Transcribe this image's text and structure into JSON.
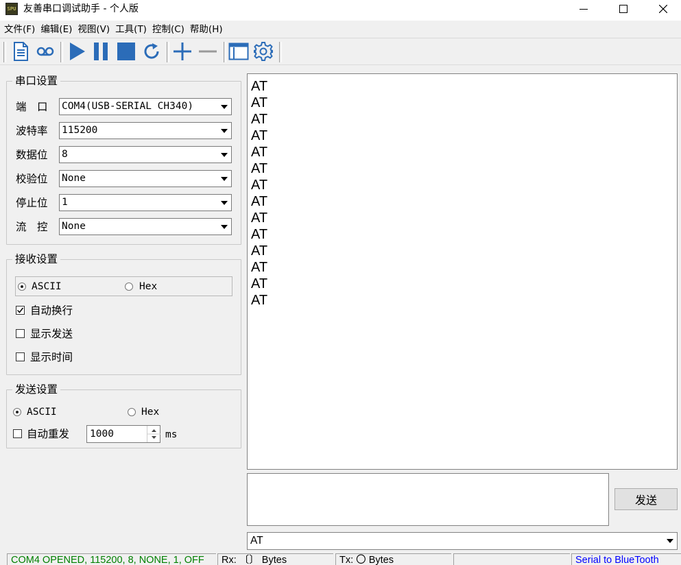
{
  "window": {
    "title": "友善串口调试助手 - 个人版",
    "icon_text": "SPU"
  },
  "menu": [
    "文件(F)",
    "编辑(E)",
    "视图(V)",
    "工具(T)",
    "控制(C)",
    "帮助(H)"
  ],
  "toolbar_icons": [
    "new-document-icon",
    "voicemail-icon",
    "play-icon",
    "pause-icon",
    "stop-icon",
    "refresh-icon",
    "plus-icon",
    "minus-icon",
    "window-icon",
    "gear-icon"
  ],
  "colors": {
    "accent": "#2b6cb8",
    "status_green": "#008000",
    "link_blue": "#0000ff"
  },
  "serial_settings": {
    "title": "串口设置",
    "fields": [
      {
        "label": "端　口",
        "value": "COM4(USB-SERIAL CH340)"
      },
      {
        "label": "波特率",
        "value": "115200"
      },
      {
        "label": "数据位",
        "value": "8"
      },
      {
        "label": "校验位",
        "value": "None"
      },
      {
        "label": "停止位",
        "value": "1"
      },
      {
        "label": "流　控",
        "value": "None"
      }
    ]
  },
  "receive_settings": {
    "title": "接收设置",
    "ascii_label": "ASCII",
    "hex_label": "Hex",
    "selected": "ASCII",
    "options": [
      {
        "label": "自动换行",
        "checked": true
      },
      {
        "label": "显示发送",
        "checked": false
      },
      {
        "label": "显示时间",
        "checked": false
      }
    ]
  },
  "send_settings": {
    "title": "发送设置",
    "ascii_label": "ASCII",
    "hex_label": "Hex",
    "selected": "ASCII",
    "auto_resend_label": "自动重发",
    "auto_resend_checked": false,
    "interval_value": "1000",
    "interval_unit": "ms"
  },
  "receive_lines": [
    "AT",
    "AT",
    "AT",
    "AT",
    "AT",
    "AT",
    "AT",
    "AT",
    "AT",
    "AT",
    "AT",
    "AT",
    "AT",
    "AT"
  ],
  "send_text": "",
  "send_button": "发送",
  "command_value": "AT",
  "status": {
    "connection": "COM4 OPENED, 115200, 8, NONE, 1, OFF",
    "rx": "Rx: 〔〕 Bytes",
    "tx": "Tx: 〇 Bytes",
    "link": "Serial to BlueTooth"
  }
}
